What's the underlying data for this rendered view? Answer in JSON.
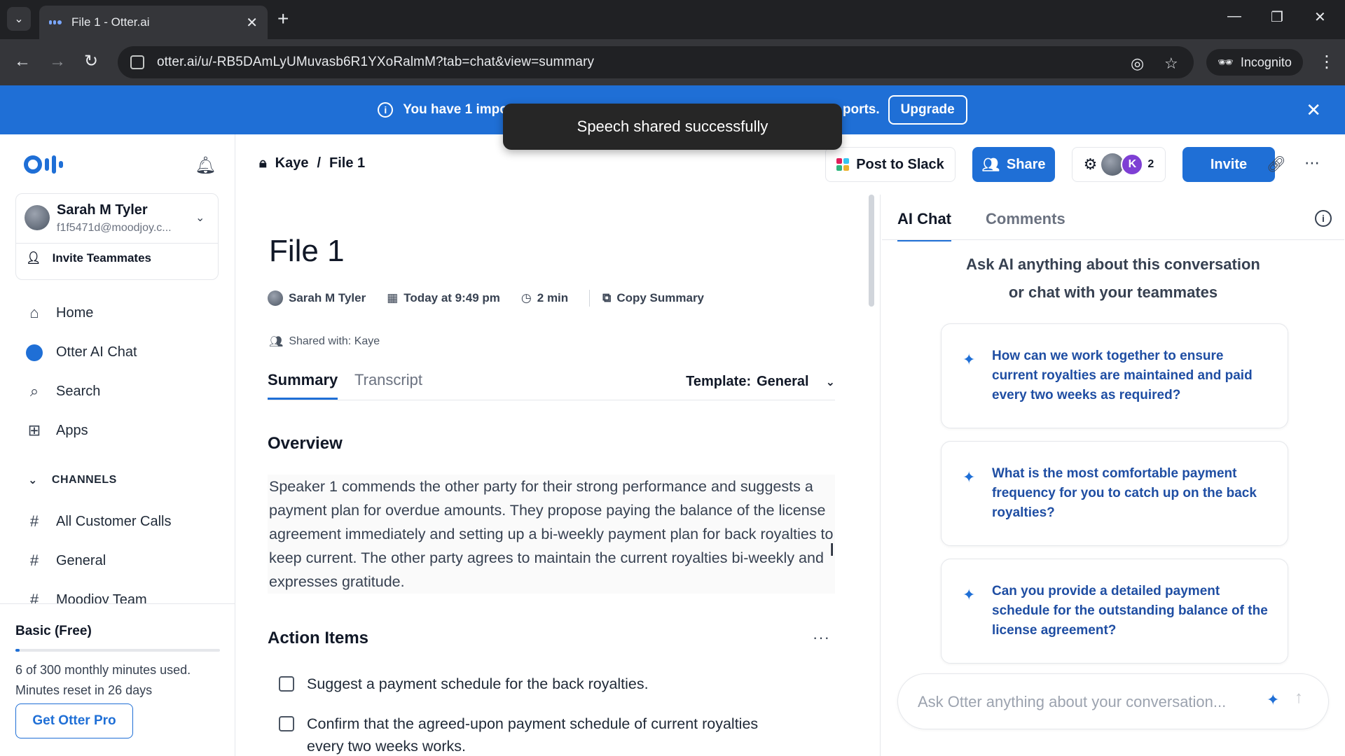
{
  "browser": {
    "tab_title": "File 1 - Otter.ai",
    "url": "otter.ai/u/-RB5DAmLyUMuvasb6R1YXoRalmM?tab=chat&view=summary",
    "incognito_label": "Incognito"
  },
  "banner": {
    "text_start": "You have 1 impo",
    "text_end": "ports.",
    "upgrade_label": "Upgrade"
  },
  "toast": "Speech shared successfully",
  "sidebar": {
    "user_name": "Sarah M Tyler",
    "user_email": "f1f5471d@moodjoy.c...",
    "invite_teammates": "Invite Teammates",
    "nav": [
      {
        "label": "Home",
        "icon": "home-icon"
      },
      {
        "label": "Otter AI Chat",
        "icon": "otter-chat-icon"
      },
      {
        "label": "Search",
        "icon": "search-icon"
      },
      {
        "label": "Apps",
        "icon": "apps-icon"
      }
    ],
    "channels_header": "CHANNELS",
    "channels": [
      "All Customer Calls",
      "General",
      "Moodjoy Team"
    ],
    "plan_name": "Basic (Free)",
    "plan_usage_fraction": 0.02,
    "plan_usage": "6 of 300 monthly minutes used.",
    "plan_reset": "Minutes reset in 26 days",
    "get_pro": "Get Otter Pro"
  },
  "header": {
    "breadcrumb_parent": "Kaye",
    "breadcrumb_sep": "/",
    "breadcrumb_current": "File 1",
    "post_to_slack": "Post to Slack",
    "share": "Share",
    "avatar_letter": "K",
    "collaborator_count": "2",
    "invite": "Invite"
  },
  "document": {
    "title": "File 1",
    "author": "Sarah M Tyler",
    "date": "Today at 9:49 pm",
    "duration": "2 min",
    "copy_summary": "Copy Summary",
    "shared_with": "Shared with: Kaye",
    "tabs": {
      "summary": "Summary",
      "transcript": "Transcript"
    },
    "template_label": "Template:",
    "template_value": "General",
    "overview_heading": "Overview",
    "overview_text": "Speaker 1 commends the other party for their strong performance and suggests a payment plan for overdue amounts. They propose paying the balance of the license agreement immediately and setting up a bi-weekly payment plan for back royalties to keep current. The other party agrees to maintain the current royalties bi-weekly and expresses gratitude.",
    "action_items_heading": "Action Items",
    "action_items": [
      "Suggest a payment schedule for the back royalties.",
      "Confirm that the agreed-upon payment schedule of current royalties every two weeks works."
    ]
  },
  "right_panel": {
    "tabs": {
      "ai_chat": "AI Chat",
      "comments": "Comments"
    },
    "intro_line1": "Ask AI anything about this conversation",
    "intro_line2": "or chat with your teammates",
    "suggestions": [
      "How can we work together to ensure current royalties are maintained and paid every two weeks as required?",
      "What is the most comfortable payment frequency for you to catch up on the back royalties?",
      "Can you provide a detailed payment schedule for the outstanding balance of the license agreement?"
    ],
    "ask_placeholder": "Ask Otter anything about your conversation..."
  },
  "colors": {
    "brand_blue": "#1f6fd6",
    "banner_blue": "#1f6fd6",
    "avatar_purple": "#7e3fd4"
  }
}
